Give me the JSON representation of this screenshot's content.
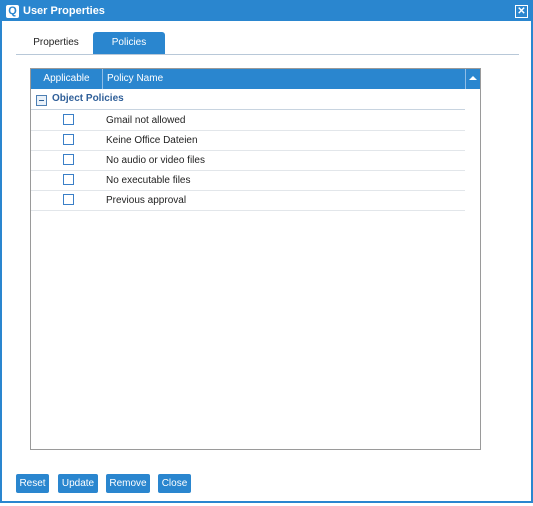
{
  "window": {
    "title": "User Properties",
    "app_icon_glyph": "Q",
    "close_glyph": "✕"
  },
  "tabs": [
    {
      "label": "Properties",
      "active": false
    },
    {
      "label": "Policies",
      "active": true
    }
  ],
  "grid": {
    "columns": {
      "applicable": "Applicable",
      "policy_name": "Policy Name"
    },
    "group": {
      "label": "Object Policies",
      "expanded": true
    },
    "rows": [
      {
        "checked": false,
        "name": "Gmail not allowed"
      },
      {
        "checked": false,
        "name": "Keine Office Dateien"
      },
      {
        "checked": false,
        "name": "No audio or video files"
      },
      {
        "checked": false,
        "name": "No executable files"
      },
      {
        "checked": false,
        "name": "Previous approval"
      }
    ]
  },
  "buttons": {
    "reset": "Reset",
    "update": "Update",
    "remove": "Remove",
    "close": "Close"
  },
  "colors": {
    "accent": "#2a86cf",
    "group_text": "#2f5f99"
  }
}
